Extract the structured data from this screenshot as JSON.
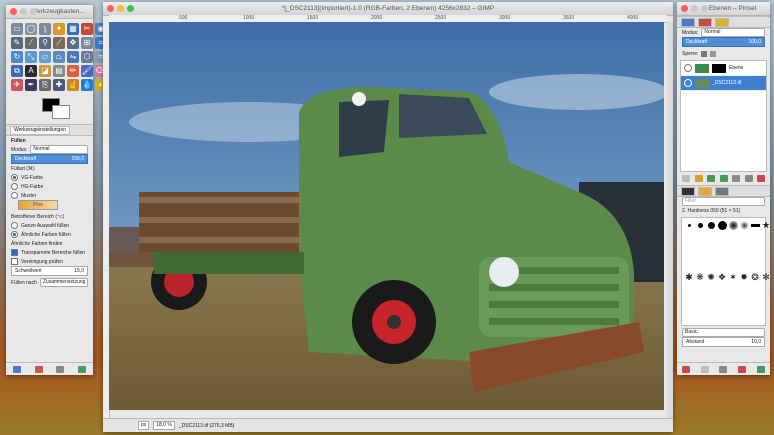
{
  "toolbox": {
    "title": "Werkzeugkasten…",
    "options_tab": "Werkzeugeinstellungen",
    "section": "Füllen",
    "mode_label": "Modus:",
    "mode_value": "Normal",
    "opacity_label": "Deckkraft",
    "opacity_value": "100,0",
    "fill_type_label": "Füllart (⌘)",
    "fill_fg": "VG-Farbe",
    "fill_bg": "HG-Farbe",
    "fill_pattern": "Muster",
    "pattern_name": "Pine",
    "affected_label": "Betroffener Bereich (⌥)",
    "fill_whole": "Ganze Auswahl füllen",
    "fill_similar": "Ähnliche Farben füllen",
    "find_similar_label": "Ähnliche Farben finden",
    "transparent_areas": "Transparente Bereiche füllen",
    "sample_merged": "Vereinigung prüfen",
    "threshold_label": "Schwellwert",
    "threshold_value": "15,0",
    "fill_by_label": "Füllen nach",
    "fill_by_value": "Zusammensetzung"
  },
  "image_window": {
    "title": "*[_DSC2113](importiert)-1.0 (RGB-Farben, 2 Ebenen) 4256x2832 – GIMP",
    "ruler_marks": [
      "500",
      "1000",
      "1500",
      "2000",
      "2500",
      "3000",
      "3500",
      "4000"
    ],
    "status_unit": "px",
    "status_zoom": "18,0 %",
    "status_text": "_DSC2113.tif (276,3 MB)"
  },
  "layers_panel": {
    "title": "Ebenen – Pinsel",
    "mode_label": "Modus:",
    "mode_value": "Normal",
    "opacity_label": "Deckkraft",
    "opacity_value": "100,0",
    "lock_label": "Sperre:",
    "layers": [
      {
        "name": "Ebene"
      },
      {
        "name": "_DSC2113.tif"
      }
    ],
    "filter_placeholder": "Filter",
    "brush_name": "2. Hardness 050 (51 × 51)",
    "brush_preset": "Basic.",
    "spacing_label": "Abstand",
    "spacing_value": "10,0"
  }
}
